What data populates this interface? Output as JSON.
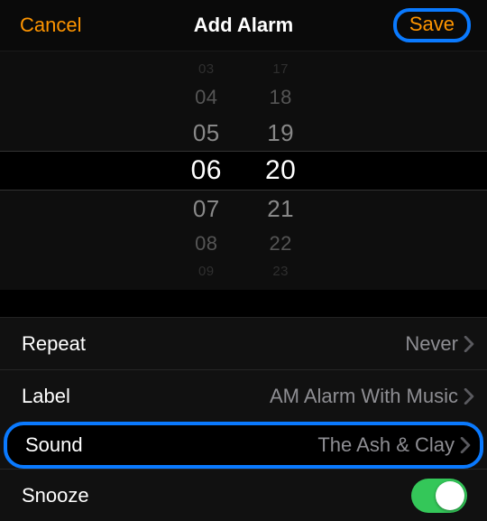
{
  "header": {
    "cancel_label": "Cancel",
    "title": "Add Alarm",
    "save_label": "Save"
  },
  "picker": {
    "hours": [
      "03",
      "04",
      "05",
      "06",
      "07",
      "08",
      "09"
    ],
    "minutes": [
      "17",
      "18",
      "19",
      "20",
      "21",
      "22",
      "23"
    ]
  },
  "settings": {
    "repeat": {
      "label": "Repeat",
      "value": "Never"
    },
    "label": {
      "label": "Label",
      "value": "AM Alarm With Music"
    },
    "sound": {
      "label": "Sound",
      "value": "The Ash & Clay"
    },
    "snooze": {
      "label": "Snooze",
      "on": true
    }
  },
  "colors": {
    "accent": "#ff9500",
    "highlight": "#0a7aff",
    "toggle_on": "#34c759"
  }
}
